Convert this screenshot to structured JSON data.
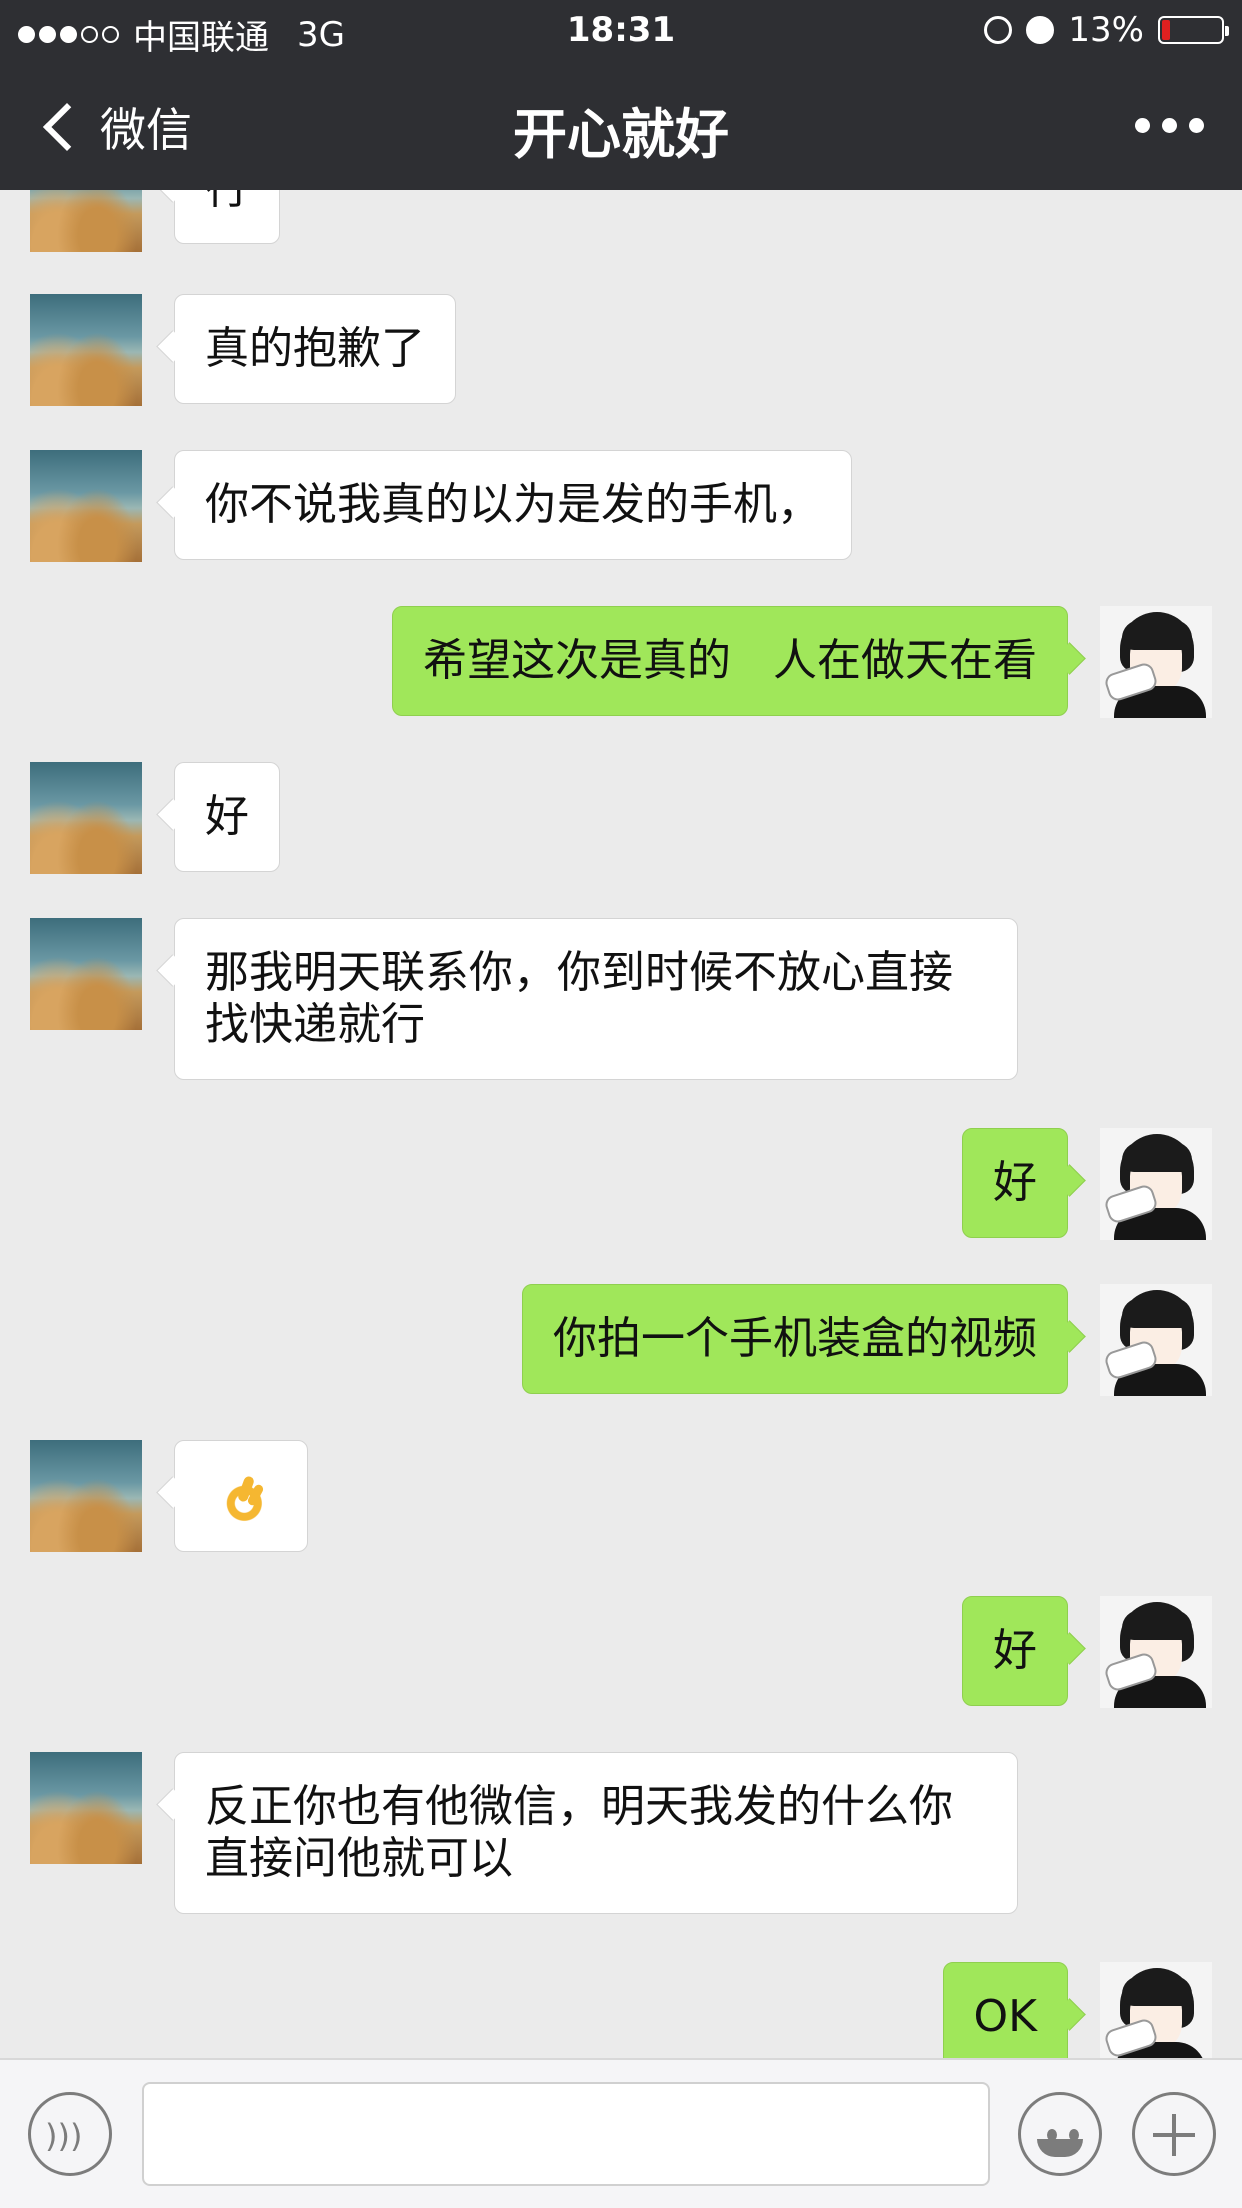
{
  "status_bar": {
    "carrier": "中国联通",
    "network": "3G",
    "time": "18:31",
    "battery_percent": "13%",
    "battery_level": 0.13,
    "signal_dots_filled": 3,
    "signal_dots_total": 5
  },
  "nav": {
    "back_label": "微信",
    "title": "开心就好"
  },
  "messages": [
    {
      "side": "left",
      "text": "行"
    },
    {
      "side": "left",
      "text": "真的抱歉了"
    },
    {
      "side": "left",
      "text": "你不说我真的以为是发的手机，"
    },
    {
      "side": "right",
      "text": "希望这次是真的   人在做天在看"
    },
    {
      "side": "left",
      "text": "好"
    },
    {
      "side": "left",
      "text": "那我明天联系你，你到时候不放心直接找快递就行"
    },
    {
      "side": "right",
      "text": "好"
    },
    {
      "side": "right",
      "text": "你拍一个手机装盒的视频"
    },
    {
      "side": "left",
      "emoji": "ok-hand-emoji"
    },
    {
      "side": "right",
      "text": "好"
    },
    {
      "side": "left",
      "text": "反正你也有他微信，明天我发的什么你直接问他就可以"
    },
    {
      "side": "right",
      "text": "OK"
    }
  ],
  "input_bar": {
    "value": "",
    "voice_icon": "voice-icon",
    "emoji_icon": "emoji-face-icon",
    "plus_icon": "plus-icon"
  },
  "colors": {
    "nav_bg": "#2e2f33",
    "chat_bg": "#ebebeb",
    "my_bubble": "#a0e75a",
    "their_bubble": "#ffffff",
    "battery_low": "#e02020"
  }
}
